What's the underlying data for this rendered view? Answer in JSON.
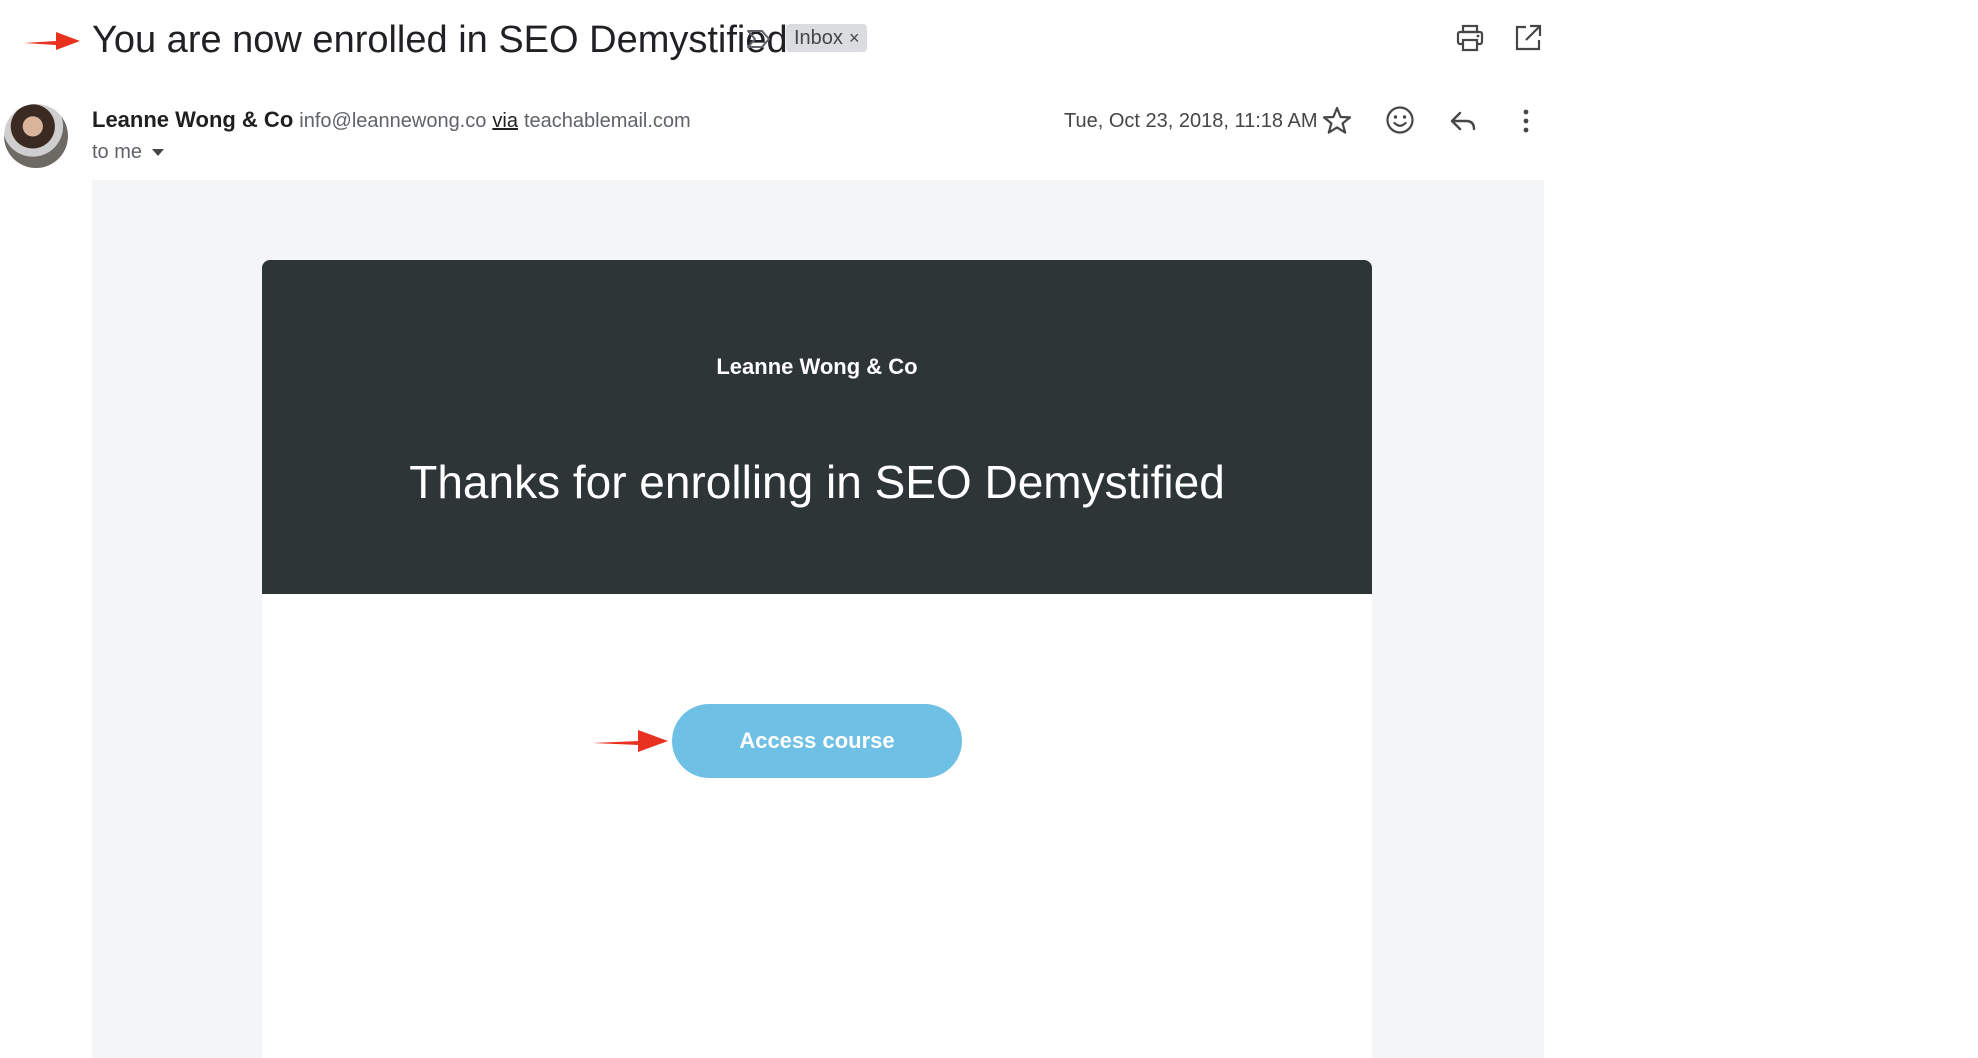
{
  "email": {
    "subject": "You are now enrolled in SEO Demystified",
    "label": "Inbox",
    "label_close": "×",
    "sender_name": "Leanne Wong & Co",
    "sender_email": "info@leannewong.co",
    "via_text": "via",
    "via_domain": "teachablemail.com",
    "recipient": "to me",
    "date": "Tue, Oct 23, 2018, 11:18 AM"
  },
  "message": {
    "brand": "Leanne Wong & Co",
    "headline": "Thanks for enrolling in SEO Demystified",
    "cta_label": "Access course"
  },
  "colors": {
    "header_bg": "#2e3537",
    "cta_bg": "#6ec0e4",
    "annotation_arrow": "#e8311f",
    "label_chip": "#dadce0"
  },
  "icons": {
    "importance": "importance-marker-icon",
    "print": "print-icon",
    "open_new_window": "open-in-new-window-icon",
    "star": "star-icon",
    "emoji": "emoji-reaction-icon",
    "reply": "reply-icon",
    "more": "more-vertical-icon",
    "annotation": "red-arrow-icon"
  }
}
